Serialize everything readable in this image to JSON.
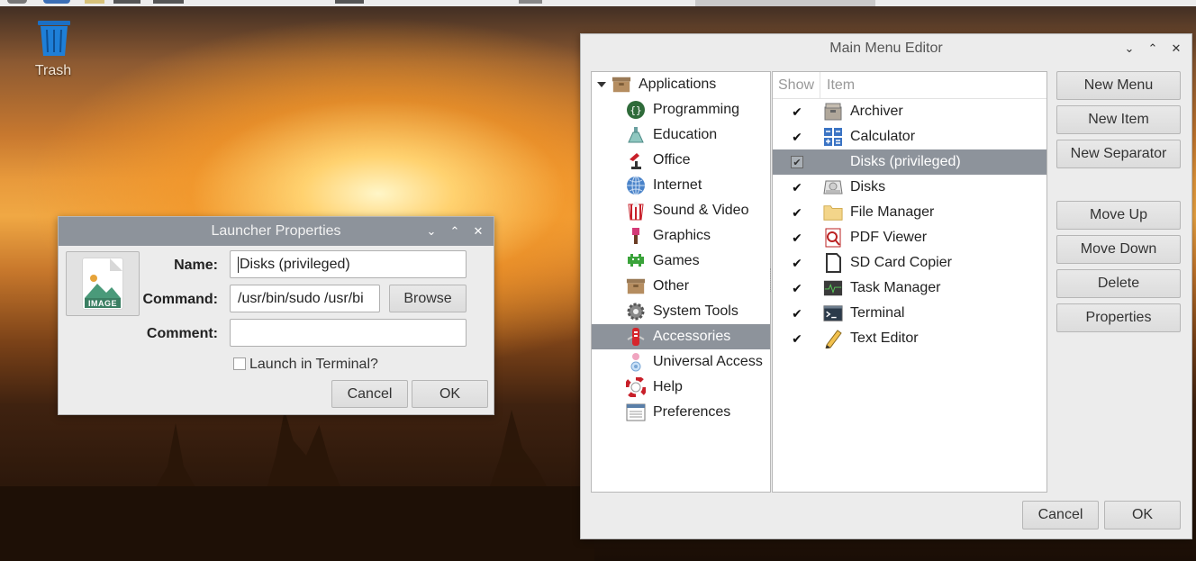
{
  "desktop": {
    "trash_label": "Trash"
  },
  "launcher": {
    "title": "Launcher Properties",
    "name_label": "Name:",
    "name_value": "Disks (privileged)",
    "command_label": "Command:",
    "command_value": "/usr/bin/sudo /usr/bi",
    "browse_label": "Browse",
    "comment_label": "Comment:",
    "comment_value": "",
    "terminal_label": "Launch in Terminal?",
    "terminal_checked": false,
    "icon_caption": "IMAGE",
    "cancel_label": "Cancel",
    "ok_label": "OK"
  },
  "editor": {
    "title": "Main Menu Editor",
    "tree": {
      "root": "Applications",
      "categories": [
        {
          "label": "Programming",
          "icon": "programming-icon"
        },
        {
          "label": "Education",
          "icon": "education-icon"
        },
        {
          "label": "Office",
          "icon": "office-icon"
        },
        {
          "label": "Internet",
          "icon": "internet-icon"
        },
        {
          "label": "Sound & Video",
          "icon": "sound-video-icon"
        },
        {
          "label": "Graphics",
          "icon": "graphics-icon"
        },
        {
          "label": "Games",
          "icon": "games-icon"
        },
        {
          "label": "Other",
          "icon": "other-icon"
        },
        {
          "label": "System Tools",
          "icon": "system-tools-icon"
        },
        {
          "label": "Accessories",
          "icon": "accessories-icon",
          "selected": true
        },
        {
          "label": "Universal Access",
          "icon": "universal-access-icon"
        },
        {
          "label": "Help",
          "icon": "help-icon"
        },
        {
          "label": "Preferences",
          "icon": "preferences-icon"
        }
      ]
    },
    "columns": {
      "show": "Show",
      "item": "Item"
    },
    "items": [
      {
        "label": "Archiver",
        "show": true,
        "icon": "archiver-icon"
      },
      {
        "label": "Calculator",
        "show": true,
        "icon": "calculator-icon"
      },
      {
        "label": "Disks (privileged)",
        "show": true,
        "icon": "none",
        "selected": true
      },
      {
        "label": "Disks",
        "show": true,
        "icon": "disks-icon"
      },
      {
        "label": "File Manager",
        "show": true,
        "icon": "folder-icon"
      },
      {
        "label": "PDF Viewer",
        "show": true,
        "icon": "pdf-viewer-icon"
      },
      {
        "label": "SD Card Copier",
        "show": true,
        "icon": "sd-card-icon"
      },
      {
        "label": "Task Manager",
        "show": true,
        "icon": "task-manager-icon"
      },
      {
        "label": "Terminal",
        "show": true,
        "icon": "terminal-icon"
      },
      {
        "label": "Text Editor",
        "show": true,
        "icon": "text-editor-icon"
      }
    ],
    "buttons": {
      "new_menu": "New Menu",
      "new_item": "New Item",
      "new_separator": "New Separator",
      "move_up": "Move Up",
      "move_down": "Move Down",
      "delete": "Delete",
      "properties": "Properties",
      "cancel": "Cancel",
      "ok": "OK"
    }
  },
  "colors": {
    "selection": "#8d939b",
    "window_bg": "#ececec"
  }
}
